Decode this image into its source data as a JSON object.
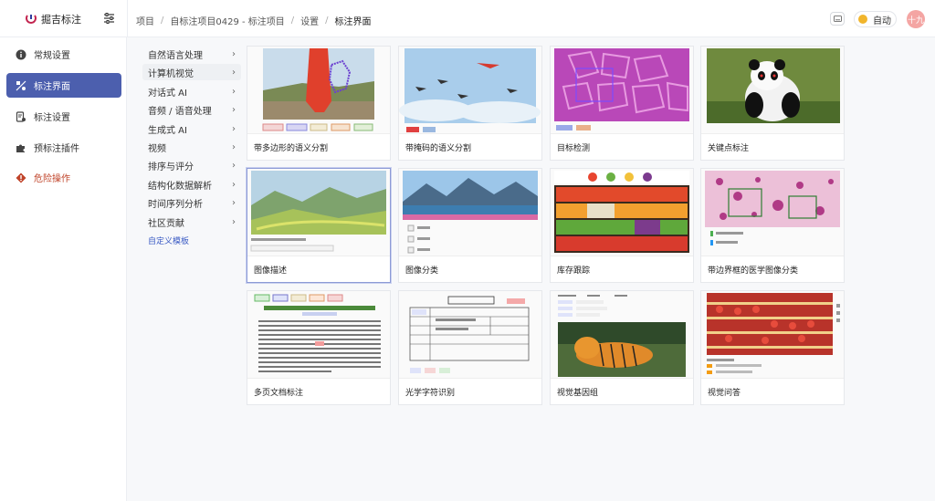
{
  "header": {
    "app_name": "掘吉标注",
    "breadcrumb": [
      "项目",
      "自标注项目0429 - 标注项目",
      "设置",
      "标注界面"
    ],
    "theme_label": "自动",
    "avatar_text": "十九"
  },
  "sidebar": {
    "items": [
      {
        "label": "常规设置",
        "icon": "info-icon"
      },
      {
        "label": "标注界面",
        "icon": "layout-icon",
        "active": true
      },
      {
        "label": "标注设置",
        "icon": "settings-doc-icon"
      },
      {
        "label": "预标注插件",
        "icon": "puzzle-icon"
      },
      {
        "label": "危险操作",
        "icon": "warning-icon",
        "danger": true
      }
    ]
  },
  "categories": {
    "items": [
      {
        "label": "自然语言处理"
      },
      {
        "label": "计算机视觉",
        "active": true
      },
      {
        "label": "对话式 AI"
      },
      {
        "label": "音频 / 语音处理"
      },
      {
        "label": "生成式 AI"
      },
      {
        "label": "视频"
      },
      {
        "label": "排序与评分"
      },
      {
        "label": "结构化数据解析"
      },
      {
        "label": "时间序列分析"
      },
      {
        "label": "社区贡献"
      }
    ],
    "custom_template": "自定义模板"
  },
  "templates": [
    {
      "label": "带多边形的语义分割"
    },
    {
      "label": "带掩码的语义分割"
    },
    {
      "label": "目标检测"
    },
    {
      "label": "关键点标注"
    },
    {
      "label": "图像描述",
      "selected": true
    },
    {
      "label": "图像分类"
    },
    {
      "label": "库存跟踪"
    },
    {
      "label": "带边界框的医学图像分类"
    },
    {
      "label": "多页文档标注"
    },
    {
      "label": "光学字符识别"
    },
    {
      "label": "视觉基因组"
    },
    {
      "label": "视觉问答"
    }
  ],
  "colors": {
    "accent": "#4c5fae",
    "danger": "#c0442a",
    "link": "#3b5bc4"
  }
}
